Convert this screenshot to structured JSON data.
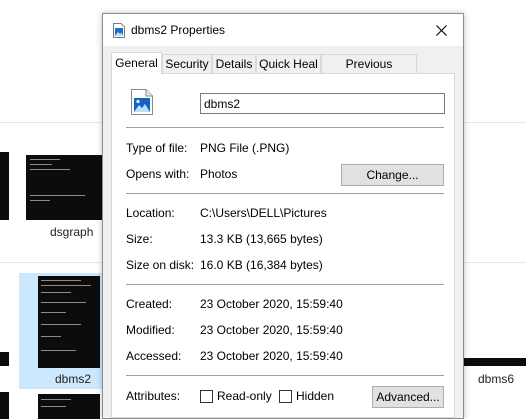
{
  "explorer": {
    "files": [
      {
        "label": "dsgraph"
      },
      {
        "label": "dbms2"
      },
      {
        "label": "dbms6"
      }
    ]
  },
  "dialog": {
    "title": "dbms2 Properties",
    "tabs": [
      "General",
      "Security",
      "Details",
      "Quick Heal",
      "Previous Versions"
    ],
    "active_tab": "General",
    "file_name": "dbms2",
    "type_of_file": {
      "label": "Type of file:",
      "value": "PNG File (.PNG)"
    },
    "opens_with": {
      "label": "Opens with:",
      "value": "Photos",
      "change_button": "Change..."
    },
    "location": {
      "label": "Location:",
      "value": "C:\\Users\\DELL\\Pictures"
    },
    "size": {
      "label": "Size:",
      "value": "13.3 KB (13,665 bytes)"
    },
    "size_on_disk": {
      "label": "Size on disk:",
      "value": "16.0 KB (16,384 bytes)"
    },
    "created": {
      "label": "Created:",
      "value": "23 October 2020, 15:59:40"
    },
    "modified": {
      "label": "Modified:",
      "value": "23 October 2020, 15:59:40"
    },
    "accessed": {
      "label": "Accessed:",
      "value": "23 October 2020, 15:59:40"
    },
    "attributes": {
      "label": "Attributes:",
      "read_only": {
        "label": "Read-only",
        "checked": false
      },
      "hidden": {
        "label": "Hidden",
        "checked": false
      },
      "advanced_button": "Advanced..."
    }
  }
}
